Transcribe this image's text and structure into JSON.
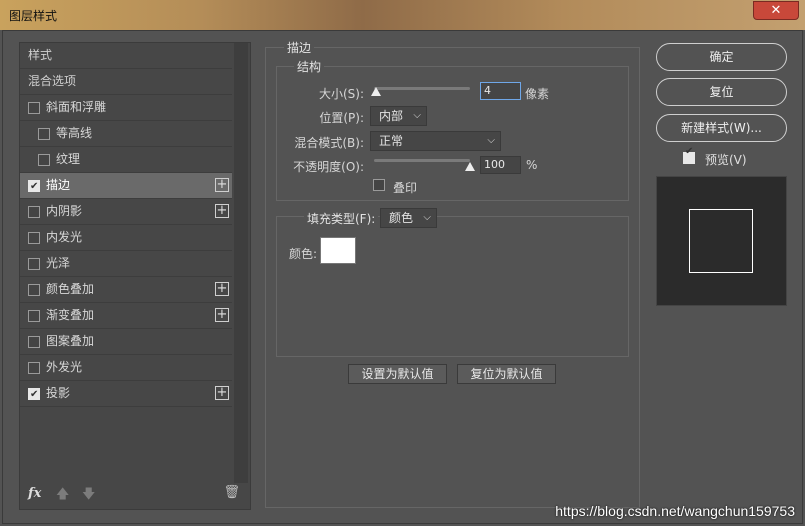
{
  "window": {
    "title": "图层样式",
    "close_glyph": "✕"
  },
  "styles_list": {
    "items": [
      {
        "label": "样式",
        "checkbox": false,
        "checked": false,
        "plus": false,
        "indent": 0,
        "selected": false
      },
      {
        "label": "混合选项",
        "checkbox": false,
        "checked": false,
        "plus": false,
        "indent": 0,
        "selected": false
      },
      {
        "label": "斜面和浮雕",
        "checkbox": true,
        "checked": false,
        "plus": false,
        "indent": 0,
        "selected": false
      },
      {
        "label": "等高线",
        "checkbox": true,
        "checked": false,
        "plus": false,
        "indent": 1,
        "selected": false
      },
      {
        "label": "纹理",
        "checkbox": true,
        "checked": false,
        "plus": false,
        "indent": 1,
        "selected": false
      },
      {
        "label": "描边",
        "checkbox": true,
        "checked": true,
        "plus": true,
        "indent": 0,
        "selected": true
      },
      {
        "label": "内阴影",
        "checkbox": true,
        "checked": false,
        "plus": true,
        "indent": 0,
        "selected": false
      },
      {
        "label": "内发光",
        "checkbox": true,
        "checked": false,
        "plus": false,
        "indent": 0,
        "selected": false
      },
      {
        "label": "光泽",
        "checkbox": true,
        "checked": false,
        "plus": false,
        "indent": 0,
        "selected": false
      },
      {
        "label": "颜色叠加",
        "checkbox": true,
        "checked": false,
        "plus": true,
        "indent": 0,
        "selected": false
      },
      {
        "label": "渐变叠加",
        "checkbox": true,
        "checked": false,
        "plus": true,
        "indent": 0,
        "selected": false
      },
      {
        "label": "图案叠加",
        "checkbox": true,
        "checked": false,
        "plus": false,
        "indent": 0,
        "selected": false
      },
      {
        "label": "外发光",
        "checkbox": true,
        "checked": false,
        "plus": false,
        "indent": 0,
        "selected": false
      },
      {
        "label": "投影",
        "checkbox": true,
        "checked": true,
        "plus": true,
        "indent": 0,
        "selected": false
      }
    ],
    "footer": {
      "fx_label": "fx",
      "up_glyph": "🡅",
      "down_glyph": "🡇",
      "trash_glyph": "🗑"
    }
  },
  "stroke": {
    "group_title": "描边",
    "structure_title": "结构",
    "size_label": "大小(S):",
    "size_value": "4",
    "size_unit": "像素",
    "position_label": "位置(P):",
    "position_value": "内部",
    "blend_label": "混合模式(B):",
    "blend_value": "正常",
    "opacity_label": "不透明度(O):",
    "opacity_value": "100",
    "opacity_unit": "%",
    "opacity_level": 1.0,
    "size_level": 0.02,
    "overprint_label": "叠印",
    "fill_type_label": "填充类型(F):",
    "fill_type_value": "颜色",
    "color_label": "颜色:",
    "color_value": "#ffffff",
    "make_default_label": "设置为默认值",
    "reset_default_label": "复位为默认值"
  },
  "actions": {
    "ok_label": "确定",
    "reset_label": "复位",
    "new_style_label": "新建样式(W)...",
    "preview_label": "预览(V)",
    "preview_checked": true
  },
  "watermark": "https://blog.csdn.net/wangchun159753"
}
